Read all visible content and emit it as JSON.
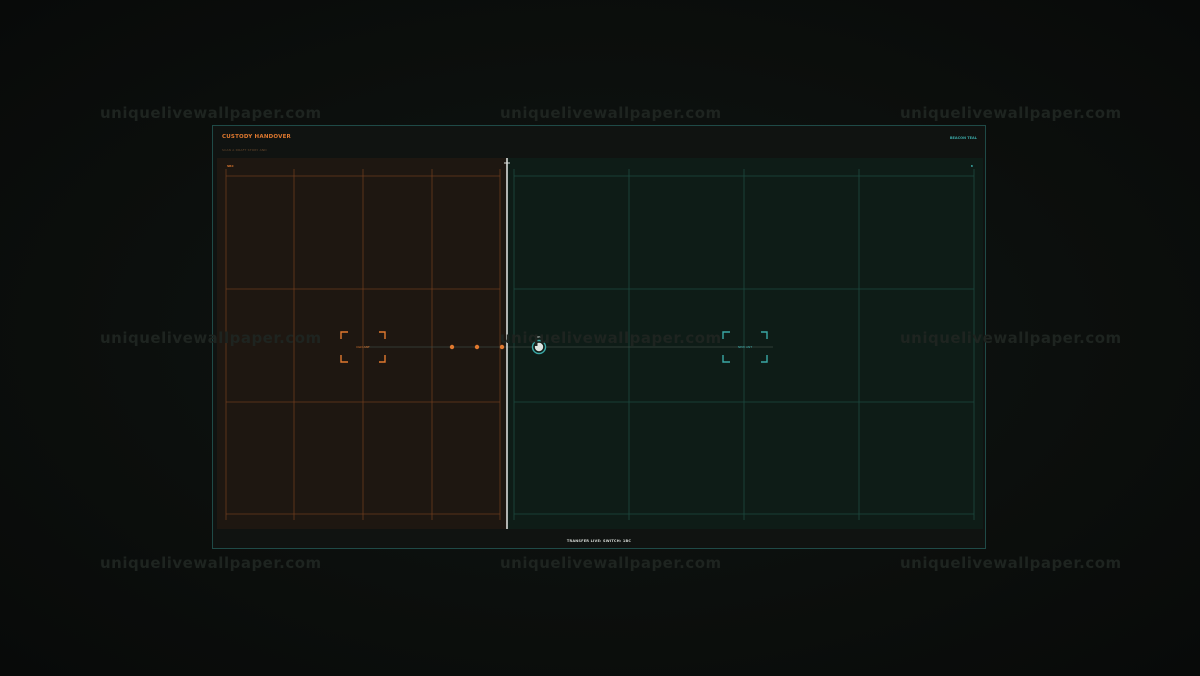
{
  "watermark": {
    "text": "uniquelivewallpaper.com"
  },
  "header": {
    "title": "CUSTODY HANDOVER",
    "subtitle": "SCAN A DRAFT STORY AND",
    "right_label": "BEACON TEAL"
  },
  "left_pane": {
    "tag": "SRC",
    "target_label": "OLD ANT",
    "accent": "#e0792f"
  },
  "right_pane": {
    "tag": "B",
    "target_label": "NEW ANT",
    "accent": "#3aa8a6"
  },
  "cursor": {
    "label": "HEX"
  },
  "footer": {
    "status": "TRANSFER LIVE: SWITCH: 1BC"
  },
  "colors": {
    "orange": "#e0792f",
    "teal": "#3aa8a6",
    "divider": "#d9dcd9"
  }
}
